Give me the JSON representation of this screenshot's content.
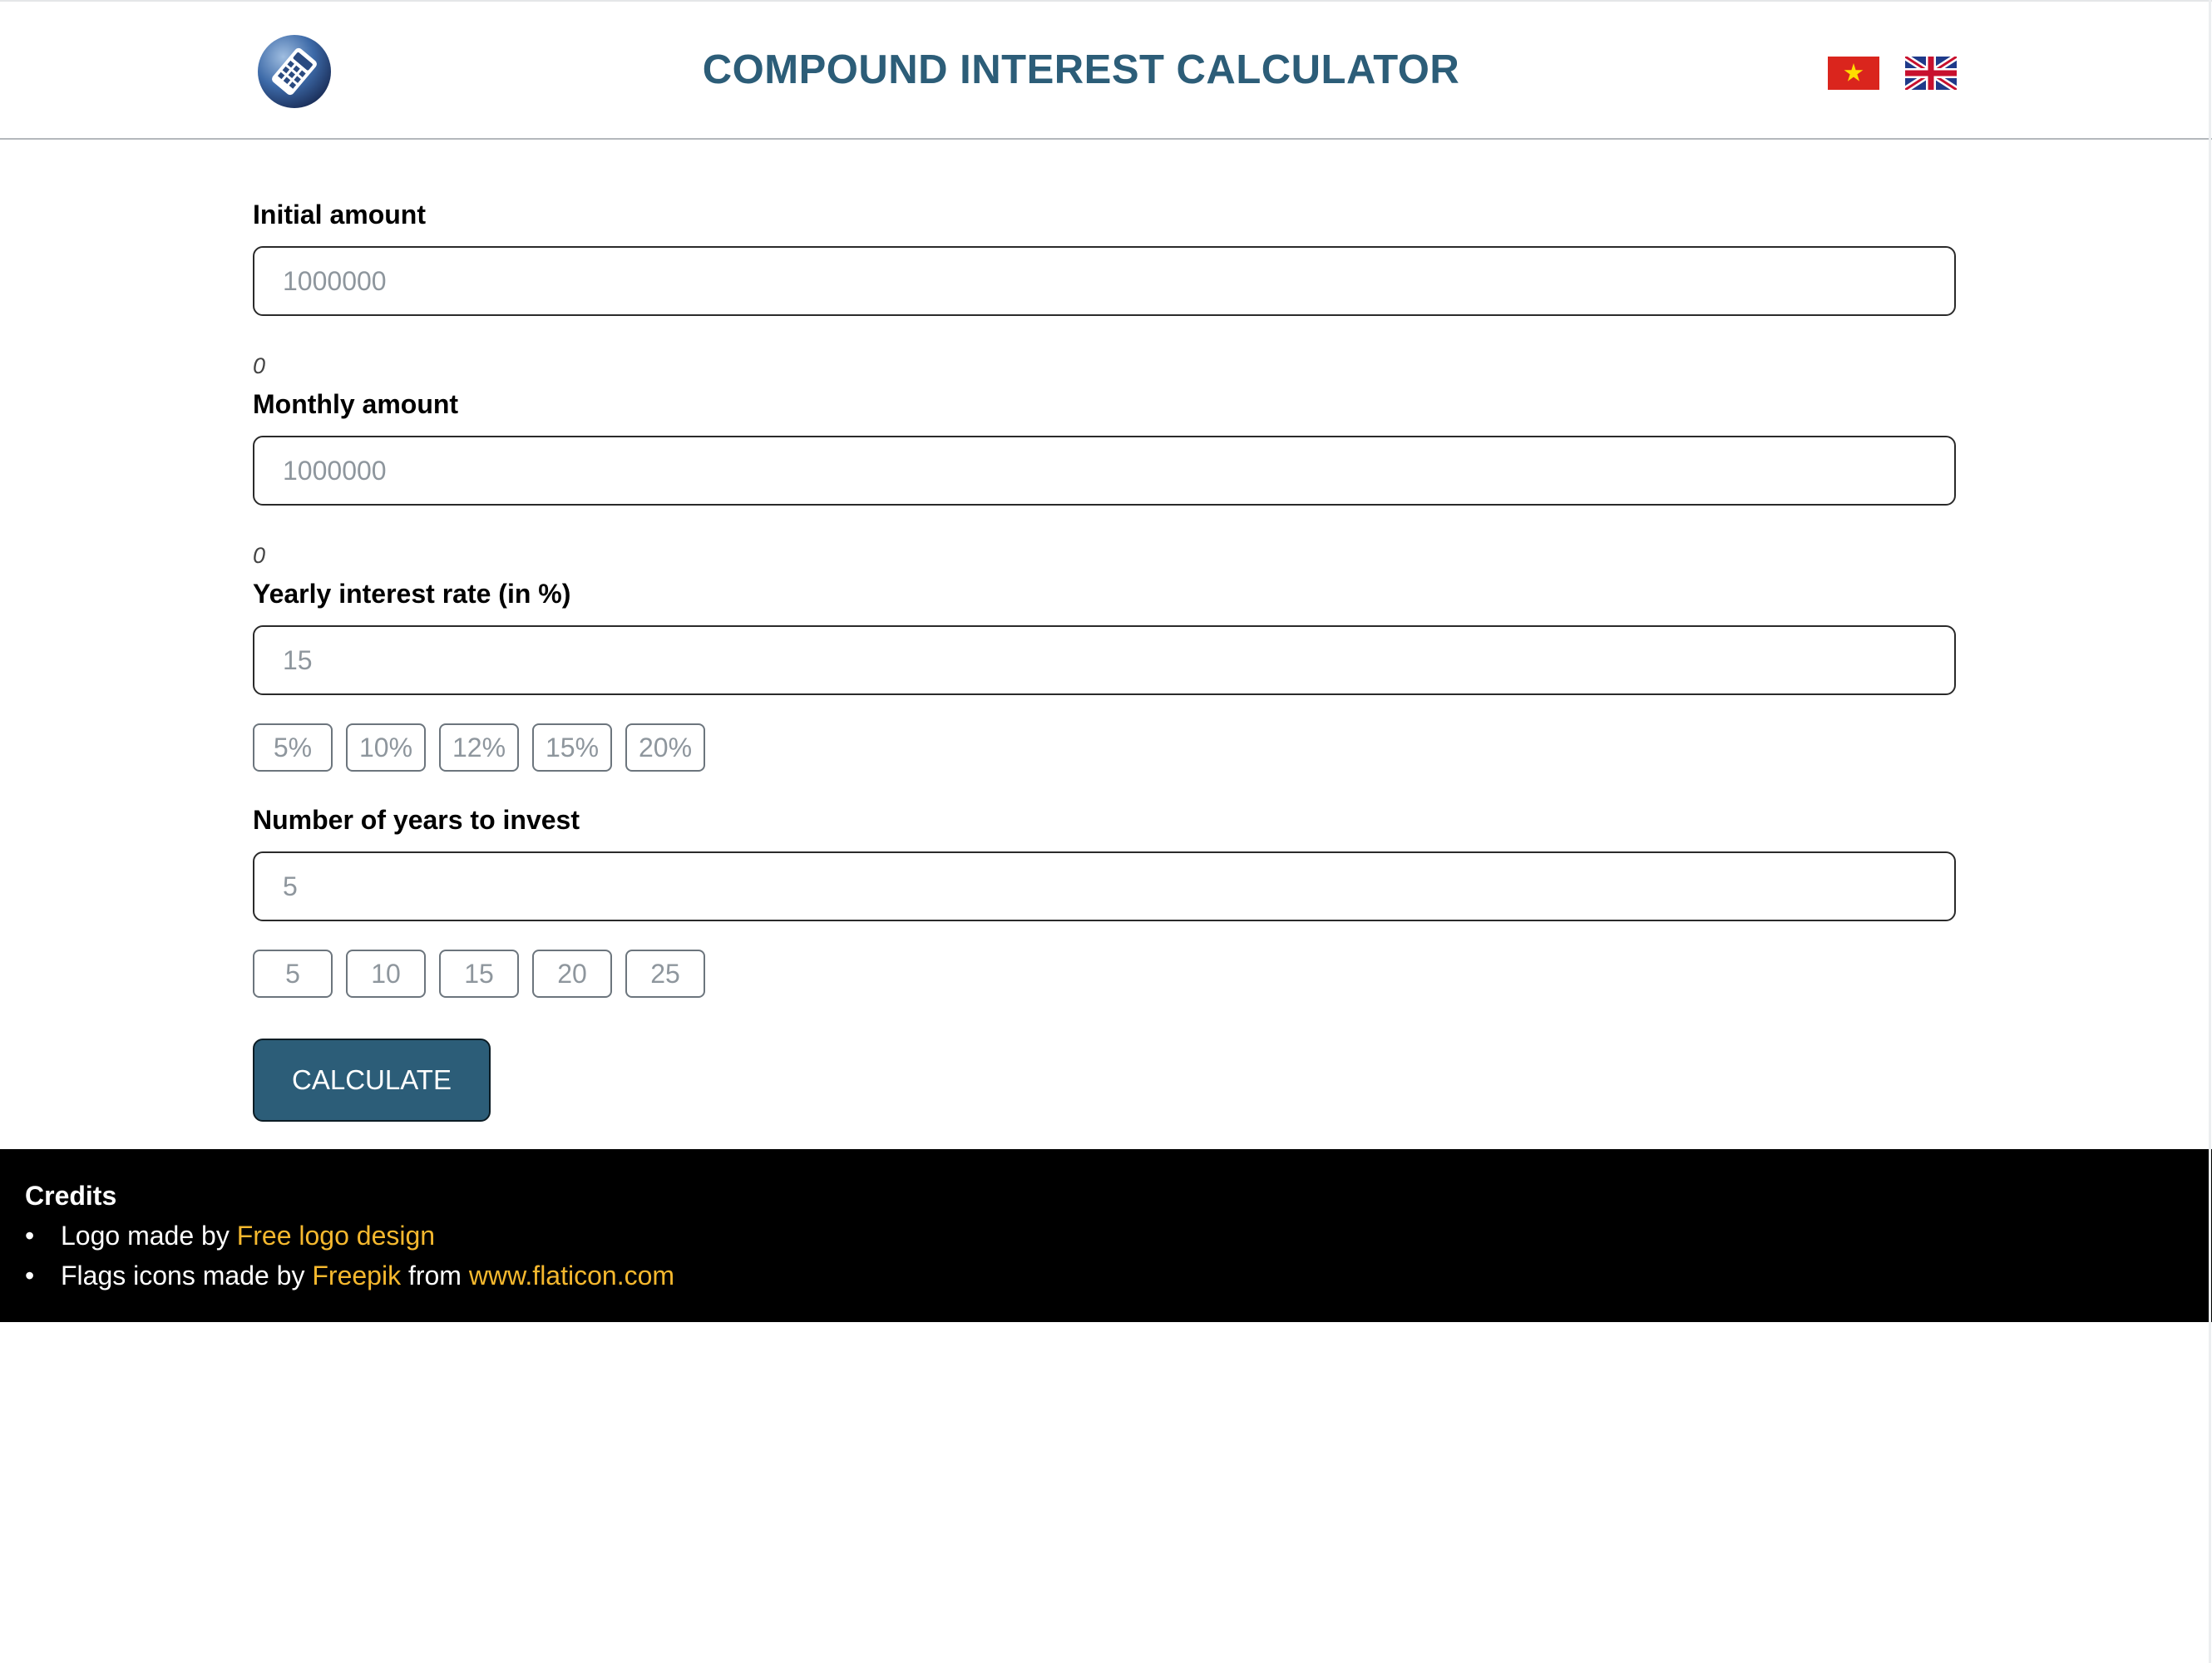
{
  "header": {
    "logo_icon": "calculator-logo-icon",
    "title": "COMPOUND INTEREST CALCULATOR",
    "flags": [
      "vietnam-flag-icon",
      "uk-flag-icon"
    ]
  },
  "form": {
    "initial": {
      "label": "Initial amount",
      "placeholder": "1000000",
      "formatted": "0"
    },
    "monthly": {
      "label": "Monthly amount",
      "placeholder": "1000000",
      "formatted": "0"
    },
    "rate": {
      "label": "Yearly interest rate (in %)",
      "placeholder": "15",
      "presets": [
        "5%",
        "10%",
        "12%",
        "15%",
        "20%"
      ]
    },
    "years": {
      "label": "Number of years to invest",
      "placeholder": "5",
      "presets": [
        "5",
        "10",
        "15",
        "20",
        "25"
      ]
    },
    "calculate_label": "CALCULATE"
  },
  "footer": {
    "title": "Credits",
    "line1": {
      "prefix": "Logo made by ",
      "link": "Free logo design"
    },
    "line2": {
      "prefix": "Flags icons made by ",
      "link1": "Freepik",
      "middle": " from ",
      "link2": "www.flaticon.com"
    }
  },
  "colors": {
    "primary": "#2c5d78",
    "link": "#f5b82e",
    "footer_bg": "#000000"
  }
}
